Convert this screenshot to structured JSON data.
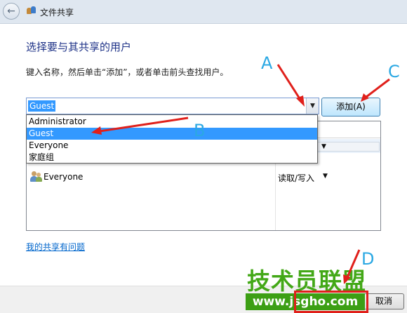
{
  "window": {
    "title": "文件共享"
  },
  "heading": "选择要与其共享的用户",
  "instruction": "键入名称，然后单击“添加”，或者单击前头查找用户。",
  "combo": {
    "value": "Guest",
    "arrow_glyph": "▼"
  },
  "add_button": {
    "label": "添加(A)"
  },
  "dropdown": {
    "options": [
      "Administrator",
      "Guest",
      "Everyone",
      "家庭组"
    ],
    "selected": "Guest"
  },
  "share_list": {
    "rows": [
      {
        "name": "Everyone",
        "permission": "读取/写入"
      }
    ]
  },
  "help_link": "我的共享有问题",
  "footer": {
    "cancel_label": "取消"
  },
  "watermark": {
    "brand": "技术员联盟",
    "url": "www.jsgho.com"
  },
  "annotations": {
    "markers": [
      "A",
      "B",
      "C",
      "D"
    ],
    "arrow_color": "#e0201b",
    "marker_color": "#2ba8e3"
  },
  "icons": {
    "back": "back-arrow-icon",
    "app": "file-share-icon",
    "user": "users-icon"
  }
}
